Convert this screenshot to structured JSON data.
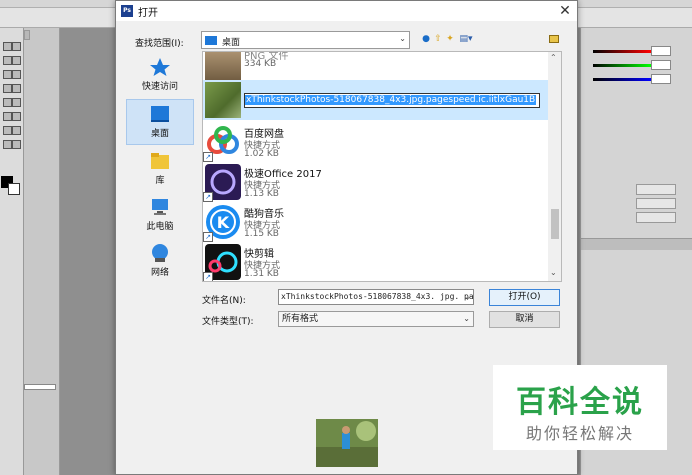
{
  "dialog": {
    "title": "打开",
    "app_icon": "Ps",
    "close_glyph": "✕",
    "lookin_label": "查找范围(I):",
    "lookin_value": "桌面",
    "places": [
      {
        "label": "快速访问",
        "icon": "star-icon"
      },
      {
        "label": "桌面",
        "icon": "desktop-icon"
      },
      {
        "label": "库",
        "icon": "library-icon"
      },
      {
        "label": "此电脑",
        "icon": "computer-icon"
      },
      {
        "label": "网络",
        "icon": "network-icon"
      }
    ],
    "files": [
      {
        "name": "PNG 文件",
        "type": "",
        "size": "334 KB"
      },
      {
        "name": "",
        "rename_value": "xThinkstockPhotos-518067838_4x3.jpg.pagespeed.ic.iitlxGau1B"
      },
      {
        "name": "百度网盘",
        "type": "快捷方式",
        "size": "1.02 KB"
      },
      {
        "name": "极速Office 2017",
        "type": "快捷方式",
        "size": "1.13 KB"
      },
      {
        "name": "酷狗音乐",
        "type": "快捷方式",
        "size": "1.15 KB"
      },
      {
        "name": "快剪辑",
        "type": "快捷方式",
        "size": "1.31 KB"
      }
    ],
    "filename_label": "文件名(N):",
    "filename_value": "xThinkstockPhotos-518067838_4x3. jpg. pa",
    "filetype_label": "文件类型(T):",
    "filetype_value": "所有格式",
    "open_label": "打开(O)",
    "cancel_label": "取消"
  },
  "watermark": {
    "title": "百科全说",
    "subtitle": "助你轻松解决"
  },
  "colors": {
    "selection": "#3399ff",
    "place_selected": "#cfe3f7",
    "watermark_green": "#2aa24a"
  }
}
